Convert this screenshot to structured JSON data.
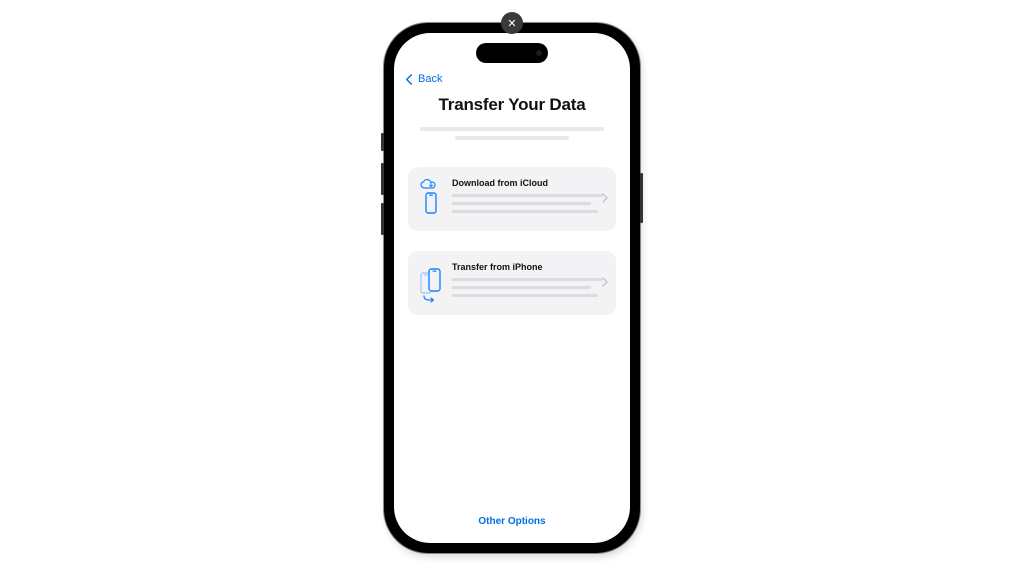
{
  "overlay": {
    "close_glyph": "✕"
  },
  "nav": {
    "back_label": "Back"
  },
  "screen": {
    "title": "Transfer Your Data",
    "options": [
      {
        "label": "Download from iCloud"
      },
      {
        "label": "Transfer from iPhone"
      }
    ],
    "footer_link": "Other Options"
  },
  "colors": {
    "accent": "#0071e3"
  }
}
